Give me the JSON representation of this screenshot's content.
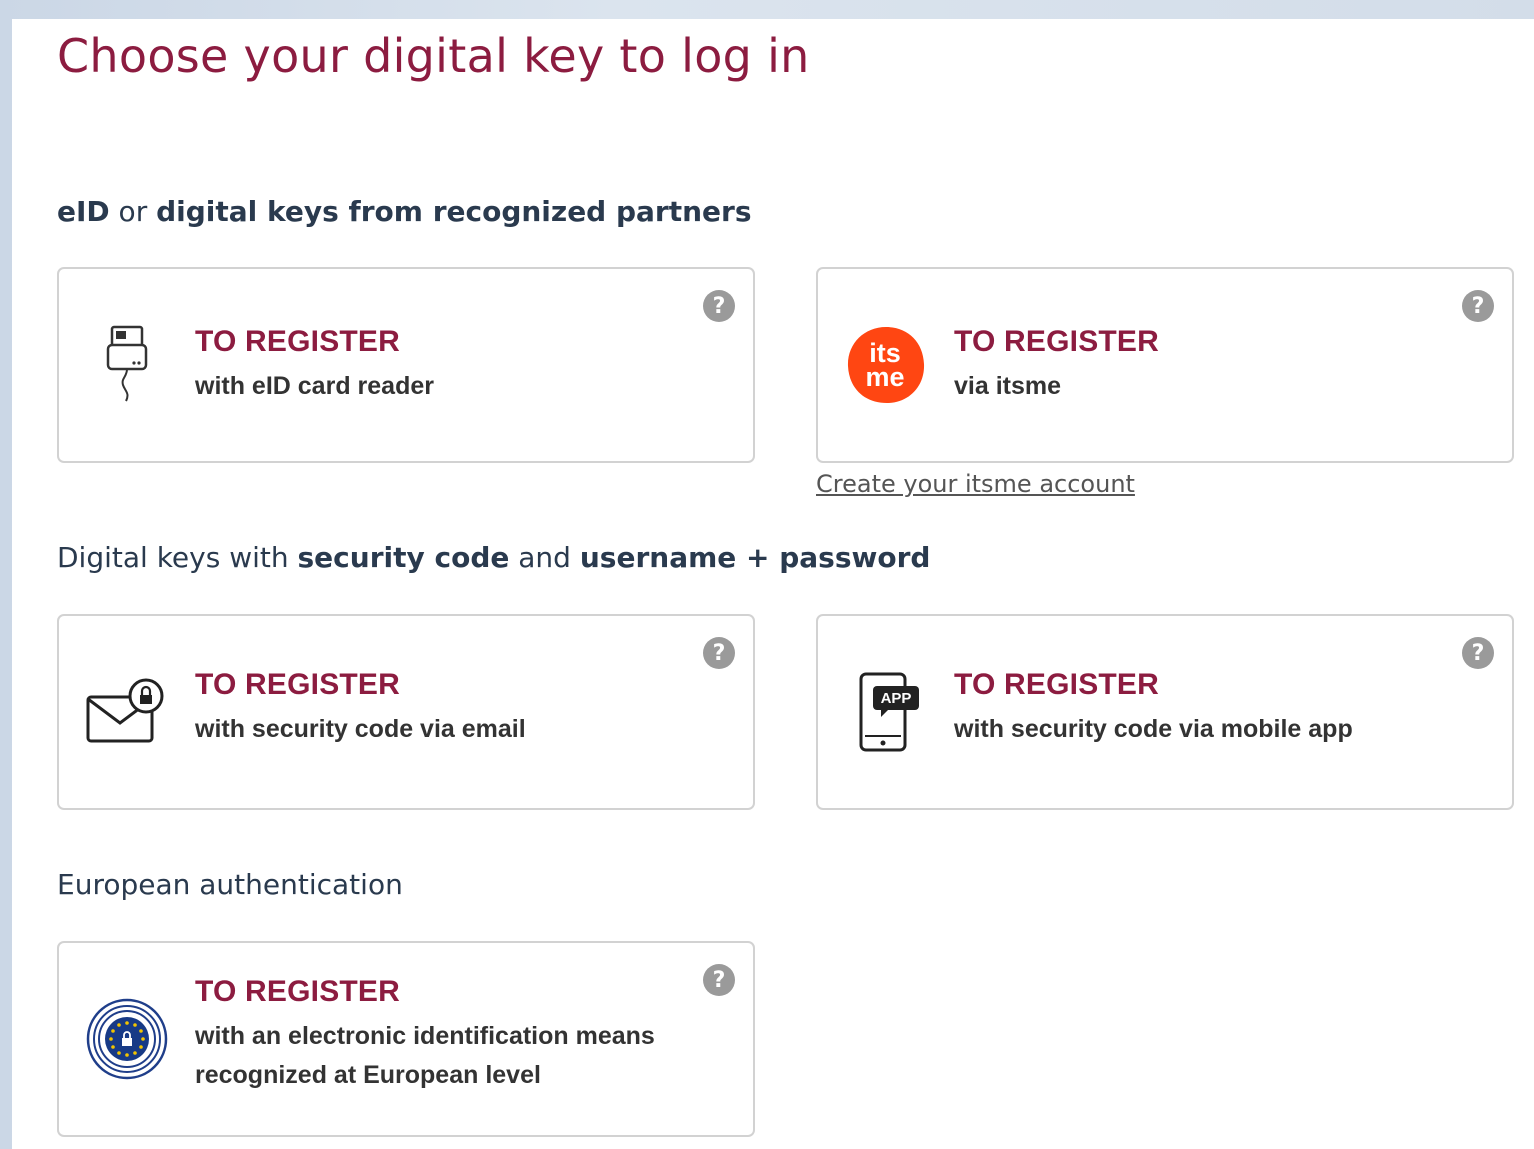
{
  "page": {
    "title": "Choose your digital key to log in",
    "accent_color": "#8c1c40",
    "heading_color": "#2a3a4e"
  },
  "sections": [
    {
      "heading_parts": [
        "eID",
        " or ",
        "digital keys from recognized partners"
      ],
      "cards": [
        {
          "title": "TO REGISTER",
          "subtitle": "with eID card reader",
          "icon": "card-reader-icon"
        },
        {
          "title": "TO REGISTER",
          "subtitle": "via itsme",
          "icon": "itsme-logo",
          "logo_text_top": "its",
          "logo_text_bottom": "me",
          "logo_color": "#ff4612"
        }
      ],
      "link": "Create your itsme account"
    },
    {
      "heading_parts": [
        "Digital keys with ",
        "security code",
        " and ",
        "username + password"
      ],
      "cards": [
        {
          "title": "TO REGISTER",
          "subtitle": "with security code via email",
          "icon": "envelope-lock-icon"
        },
        {
          "title": "TO REGISTER",
          "subtitle": "with security code via mobile app",
          "icon": "mobile-app-icon",
          "badge": "APP"
        }
      ]
    },
    {
      "heading_parts": [
        "European authentication"
      ],
      "cards": [
        {
          "title": "TO REGISTER",
          "subtitle_lines": [
            "with an electronic identification means",
            "recognized at European level"
          ],
          "icon": "eu-identification-icon"
        }
      ]
    }
  ],
  "help_symbol": "?"
}
